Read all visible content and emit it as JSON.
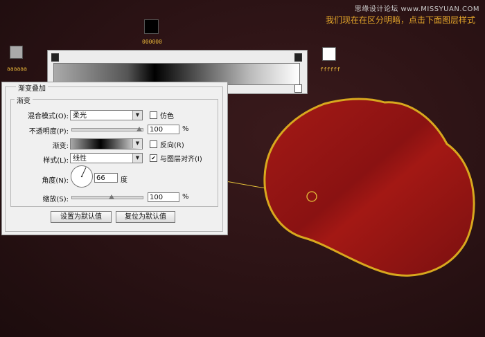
{
  "watermark": "思缘设计论坛 www.MISSYUAN.COM",
  "instruction": "我们现在在区分明暗，点击下面图层样式",
  "swatches": {
    "left": {
      "label": "aaaaaa",
      "color": "#aaaaaa"
    },
    "middle": {
      "label": "000000",
      "color": "#000000"
    },
    "right": {
      "label": "ffffff",
      "color": "#ffffff"
    }
  },
  "dialog": {
    "title": "渐变叠加",
    "group_title": "渐变",
    "blend_mode_label": "混合模式(O):",
    "blend_mode_value": "柔光",
    "dither_label": "仿色",
    "opacity_label": "不透明度(P):",
    "opacity_value": "100",
    "opacity_percent": 1.0,
    "gradient_label": "渐变:",
    "reverse_label": "反向(R)",
    "style_label": "样式(L):",
    "style_value": "线性",
    "align_label": "与图层对齐(I)",
    "align_checked": true,
    "angle_label": "角度(N):",
    "angle_value": "66",
    "angle_unit": "度",
    "scale_label": "缩放(S):",
    "scale_value": "100",
    "percent_unit": "%",
    "default_button": "设置为默认值",
    "reset_button": "复位为默认值"
  },
  "colors": {
    "background": "#2a1214",
    "shape_fill": "#8b1414",
    "shape_outline": "#d8a81e",
    "annotation": "#e6b43a"
  }
}
